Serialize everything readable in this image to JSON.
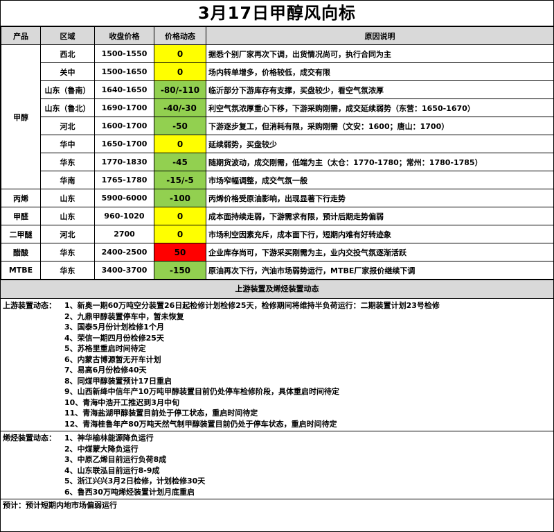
{
  "title": "3月17日甲醇风向标",
  "headers": [
    "产品",
    "区域",
    "收盘价格",
    "价格动态",
    "原因说明"
  ],
  "colors": {
    "yellow": "#ffff00",
    "green": "#92d050",
    "red": "#ff0000",
    "header_gray": "#d9d9d9"
  },
  "rows": [
    {
      "product": "甲醇",
      "region": "西北",
      "price": "1500-1550",
      "change": "0",
      "change_color": "yellow",
      "reason": "据悉个别厂家再次下调，出货情况尚可，执行合同为主"
    },
    {
      "product": "甲醇",
      "region": "关中",
      "price": "1500-1650",
      "change": "0",
      "change_color": "yellow",
      "reason": "场内转单增多，价格较低，成交有限"
    },
    {
      "product": "甲醇",
      "region": "山东（鲁南）",
      "price": "1640-1650",
      "change": "-80/-110",
      "change_color": "green",
      "reason": "临沂部分下游库存有支撑，买盘较少，看空气氛浓厚"
    },
    {
      "product": "甲醇",
      "region": "山东（鲁北）",
      "price": "1690-1700",
      "change": "-40/-30",
      "change_color": "green",
      "reason": "利空气氛浓厚重心下移，下游采购刚需，成交延续弱势（东营：1650-1670）"
    },
    {
      "product": "甲醇",
      "region": "河北",
      "price": "1600-1700",
      "change": "-50",
      "change_color": "green",
      "reason": "下游逐步复工，但消耗有限，采购刚需（文安：1600；唐山：1700）"
    },
    {
      "product": "甲醇",
      "region": "华中",
      "price": "1650-1700",
      "change": "0",
      "change_color": "yellow",
      "reason": "延续弱势，买盘较少"
    },
    {
      "product": "甲醇",
      "region": "华东",
      "price": "1770-1830",
      "change": "-45",
      "change_color": "green",
      "reason": "随期货波动，成交刚需，低端为主（太仓：1770-1780；常州：1780-1785）"
    },
    {
      "product": "甲醇",
      "region": "华南",
      "price": "1765-1780",
      "change": "-15/-5",
      "change_color": "green",
      "reason": "市场窄幅调整，成交气氛一般"
    },
    {
      "product": "丙烯",
      "region": "山东",
      "price": "5900-6000",
      "change": "-100",
      "change_color": "green",
      "reason": "丙烯价格受原油影响，出现显著下行走势"
    },
    {
      "product": "甲醛",
      "region": "山东",
      "price": "960-1020",
      "change": "0",
      "change_color": "yellow",
      "reason": "成本面持续走弱，下游需求有限，预计后期走势偏弱"
    },
    {
      "product": "二甲醚",
      "region": "河北",
      "price": "2700",
      "change": "0",
      "change_color": "yellow",
      "reason": "市场利空因素充斥，成本面下行，短期内难有好转迹象"
    },
    {
      "product": "醋酸",
      "region": "华东",
      "price": "2400-2500",
      "change": "50",
      "change_color": "red",
      "reason": "企业库存尚可，下游采买刚需为主，业内交投气氛逐渐活跃"
    },
    {
      "product": "MTBE",
      "region": "华东",
      "price": "3400-3700",
      "change": "-150",
      "change_color": "green",
      "reason": "原油再次下行，汽油市场弱势运行，MTBE厂家报价继续下调"
    }
  ],
  "section_header": "上游装置及烯烃装置动态",
  "upstream": {
    "label": "上游装置动态：",
    "items": [
      "1、新奥一期60万吨空分装置26日起检修计划检修25天，检修期间将维持半负荷运行：二期装置计划23号检修",
      "2、九鼎甲醇装置停车中，暂未恢复",
      "3、国泰5月份计划检修1个月",
      "4、荣信一期四月份检修25天",
      "5、苏格里重启时间待定",
      "6、内蒙古博源暂无开车计划",
      "7、易高6月份检修40天",
      "8、同煤甲醇装置预计17日重启",
      "9、山西新绛中信年产10万吨甲醇装置目前仍处停车检修阶段，具体重启时间待定",
      "10、青海中浩开工推迟到3月中旬",
      "11、青海盐湖甲醇装置目前处于停工状态，重启时间待定",
      "12、青海桂鲁年产80万吨天然气制甲醇装置目前仍处于停车状态，重启时间待定"
    ]
  },
  "olefin": {
    "label": "烯烃装置动态：",
    "items": [
      "1、神华榆林能源降负运行",
      "2、中煤蒙大降负运行",
      "3、中原乙烯目前运行负荷8成",
      "4、山东联泓目前运行8-9成",
      "5、浙江兴兴3月2日检修，计划检修30天",
      "6、鲁西30万吨烯烃装置计划月底重启"
    ]
  },
  "forecast": "预计：预计短期内地市场偏弱运行"
}
